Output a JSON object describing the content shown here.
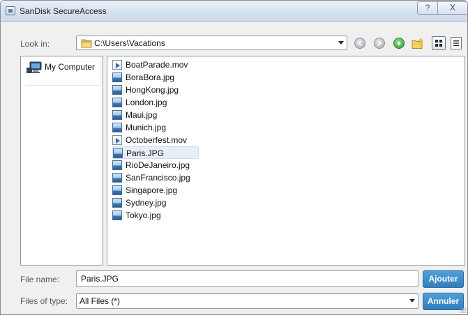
{
  "window": {
    "title": "SanDisk SecureAccess",
    "help_glyph": "?",
    "close_glyph": "X"
  },
  "toolbar": {
    "look_in_label": "Look in:",
    "look_in_value": "C:\\Users\\Vacations",
    "icons": [
      "back-icon",
      "forward-icon",
      "up-folder-icon",
      "new-folder-icon",
      "views-menu-icon",
      "list-view-icon"
    ]
  },
  "places": {
    "items": [
      {
        "label": "My Computer",
        "icon": "computer-icon"
      }
    ]
  },
  "files": {
    "selected": "Paris.JPG",
    "items": [
      {
        "name": "BoatParade.mov",
        "type": "mov"
      },
      {
        "name": "BoraBora.jpg",
        "type": "img"
      },
      {
        "name": "HongKong.jpg",
        "type": "img"
      },
      {
        "name": "London.jpg",
        "type": "img"
      },
      {
        "name": "Maui.jpg",
        "type": "img"
      },
      {
        "name": "Munich.jpg",
        "type": "img"
      },
      {
        "name": "Octoberfest.mov",
        "type": "mov"
      },
      {
        "name": "Paris.JPG",
        "type": "img"
      },
      {
        "name": "RioDeJaneiro.jpg",
        "type": "img"
      },
      {
        "name": "SanFrancisco.jpg",
        "type": "img"
      },
      {
        "name": "Singapore.jpg",
        "type": "img"
      },
      {
        "name": "Sydney.jpg",
        "type": "img"
      },
      {
        "name": "Tokyo.jpg",
        "type": "img"
      }
    ]
  },
  "footer": {
    "file_name_label": "File name:",
    "file_name_value": "Paris.JPG",
    "file_type_label": "Files of type:",
    "file_type_value": "All Files (*)",
    "add_button": "Ajouter",
    "cancel_button": "Annuler"
  },
  "colors": {
    "accent_button": "#2f7fc0",
    "selection": "#e8eef6",
    "up_arrow_green": "#2e9a2e"
  }
}
